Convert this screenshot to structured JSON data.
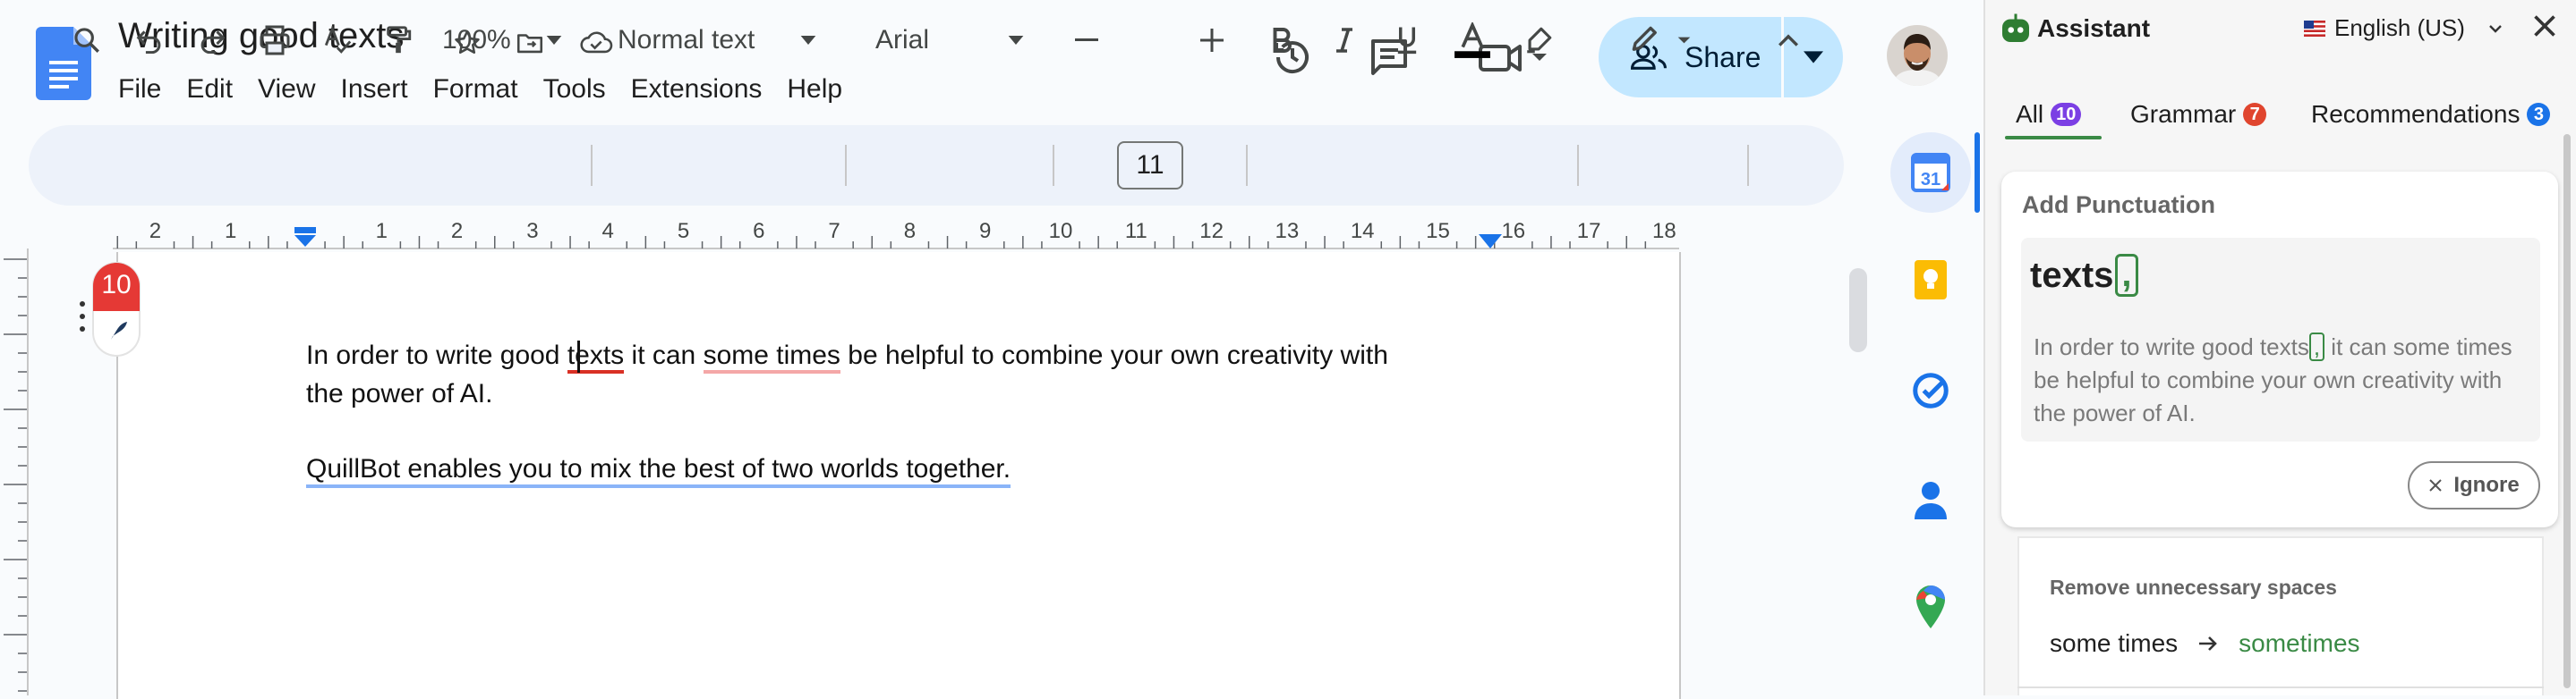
{
  "doc": {
    "title": "Writing good texts",
    "menu": [
      "File",
      "Edit",
      "View",
      "Insert",
      "Format",
      "Tools",
      "Extensions",
      "Help"
    ],
    "share_label": "Share"
  },
  "toolbar": {
    "zoom": "100%",
    "style": "Normal text",
    "font": "Arial",
    "font_size": "11"
  },
  "ruler": {
    "numbers": [
      "2",
      "1",
      "1",
      "2",
      "3",
      "4",
      "5",
      "6",
      "7",
      "8",
      "9",
      "10",
      "11",
      "12",
      "13",
      "14",
      "15",
      "16",
      "17",
      "18"
    ]
  },
  "content": {
    "p1_a": "In order to write good ",
    "p1_err1": "texts",
    "p1_b": " it can ",
    "p1_err2": "some times",
    "p1_c": " be helpful to combine your own creativity with",
    "p1_line2": "the power of AI.",
    "p2": "QuillBot enables you to mix the best of two worlds together."
  },
  "badge_count": "10",
  "assistant": {
    "title": "Assistant",
    "language": "English (US)",
    "tabs": [
      {
        "label": "All",
        "count": "10",
        "color": "#7b3fe4"
      },
      {
        "label": "Grammar",
        "count": "7",
        "color": "#e0452e"
      },
      {
        "label": "Recommendations",
        "count": "3",
        "color": "#1a73e8"
      }
    ],
    "card1": {
      "title": "Add Punctuation",
      "word": "texts",
      "insert": ",",
      "body_before": "In order to write good texts",
      "body_insert": ",",
      "body_after": " it can some times be helpful to combine your own creativity with the power of AI.",
      "ignore_label": "Ignore"
    },
    "card2": {
      "title": "Remove unnecessary spaces",
      "from": "some times",
      "to": "sometimes"
    }
  },
  "colors": {
    "accent_green": "#3a8a45",
    "share_bg": "#c2e7ff",
    "error_red": "#d93025"
  }
}
